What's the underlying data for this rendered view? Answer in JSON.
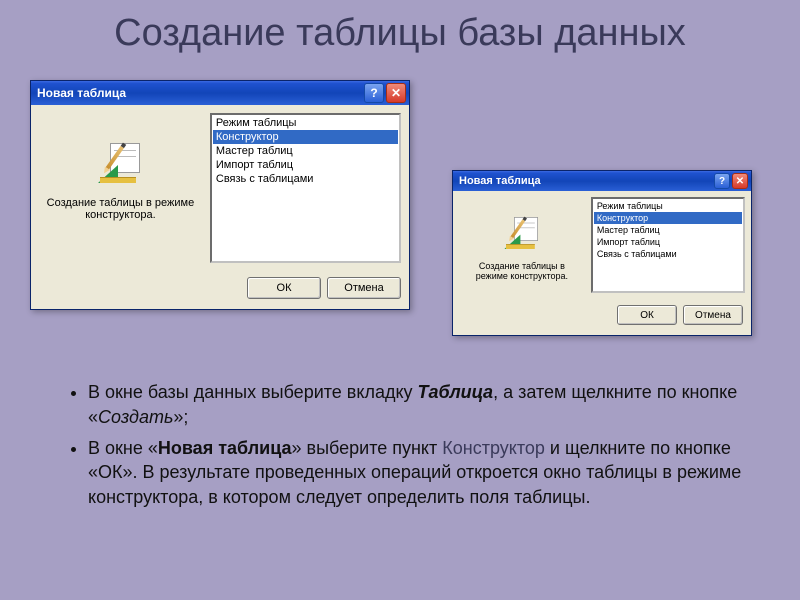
{
  "slide": {
    "title": "Создание таблицы базы данных"
  },
  "dialog": {
    "title": "Новая таблица",
    "left_caption": "Создание таблицы в режиме конструктора.",
    "list": {
      "items": [
        "Режим таблицы",
        "Конструктор",
        "Мастер таблиц",
        "Импорт таблиц",
        "Связь с таблицами"
      ],
      "selected_index": 1
    },
    "buttons": {
      "ok": "ОК",
      "cancel": "Отмена"
    }
  },
  "bullets": {
    "items": [
      {
        "parts": [
          {
            "t": "В окне базы данных выберите вкладку "
          },
          {
            "t": "Таблица",
            "cls": "bi"
          },
          {
            "t": ", а затем щелкните по кнопке «"
          },
          {
            "t": "Создать",
            "cls": "i"
          },
          {
            "t": "»;"
          }
        ]
      },
      {
        "parts": [
          {
            "t": "В окне «"
          },
          {
            "t": "Новая таблица",
            "cls": "b"
          },
          {
            "t": "» выберите пункт "
          },
          {
            "t": "Конструктор",
            "cls": "secondary"
          },
          {
            "t": " и щелкните по кнопке «ОК». В результате проведенных операций откроется окно таблицы в режиме конструктора, в котором следует определить поля таблицы."
          }
        ]
      }
    ]
  }
}
